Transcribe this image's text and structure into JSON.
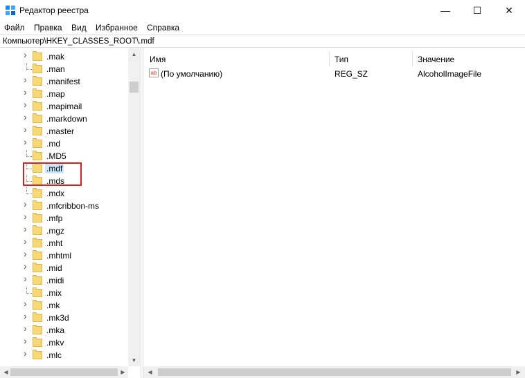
{
  "window": {
    "title": "Редактор реестра",
    "minimize_glyph": "—",
    "maximize_glyph": "☐",
    "close_glyph": "✕"
  },
  "menu": [
    "Файл",
    "Правка",
    "Вид",
    "Избранное",
    "Справка"
  ],
  "address": "Компьютер\\HKEY_CLASSES_ROOT\\.mdf",
  "tree": {
    "items": [
      {
        "label": ".mak",
        "expandable": true
      },
      {
        "label": ".man",
        "expandable": false
      },
      {
        "label": ".manifest",
        "expandable": true
      },
      {
        "label": ".map",
        "expandable": true
      },
      {
        "label": ".mapimail",
        "expandable": true
      },
      {
        "label": ".markdown",
        "expandable": true
      },
      {
        "label": ".master",
        "expandable": true
      },
      {
        "label": ".md",
        "expandable": true
      },
      {
        "label": ".MD5",
        "expandable": false
      },
      {
        "label": ".mdf",
        "expandable": false,
        "selected": true
      },
      {
        "label": ".mds",
        "expandable": false
      },
      {
        "label": ".mdx",
        "expandable": false
      },
      {
        "label": ".mfcribbon-ms",
        "expandable": true
      },
      {
        "label": ".mfp",
        "expandable": true
      },
      {
        "label": ".mgz",
        "expandable": true
      },
      {
        "label": ".mht",
        "expandable": true
      },
      {
        "label": ".mhtml",
        "expandable": true
      },
      {
        "label": ".mid",
        "expandable": true
      },
      {
        "label": ".midi",
        "expandable": true
      },
      {
        "label": ".mix",
        "expandable": false
      },
      {
        "label": ".mk",
        "expandable": true
      },
      {
        "label": ".mk3d",
        "expandable": true
      },
      {
        "label": ".mka",
        "expandable": true
      },
      {
        "label": ".mkv",
        "expandable": true
      },
      {
        "label": ".mlc",
        "expandable": true
      }
    ]
  },
  "list": {
    "columns": [
      "Имя",
      "Тип",
      "Значение"
    ],
    "rows": [
      {
        "icon": "ab",
        "name": "(По умолчанию)",
        "type": "REG_SZ",
        "value": "AlcoholImageFile"
      }
    ]
  },
  "colors": {
    "selection": "#cce8ff",
    "highlight_border": "#d32020",
    "folder": "#f8d775"
  }
}
